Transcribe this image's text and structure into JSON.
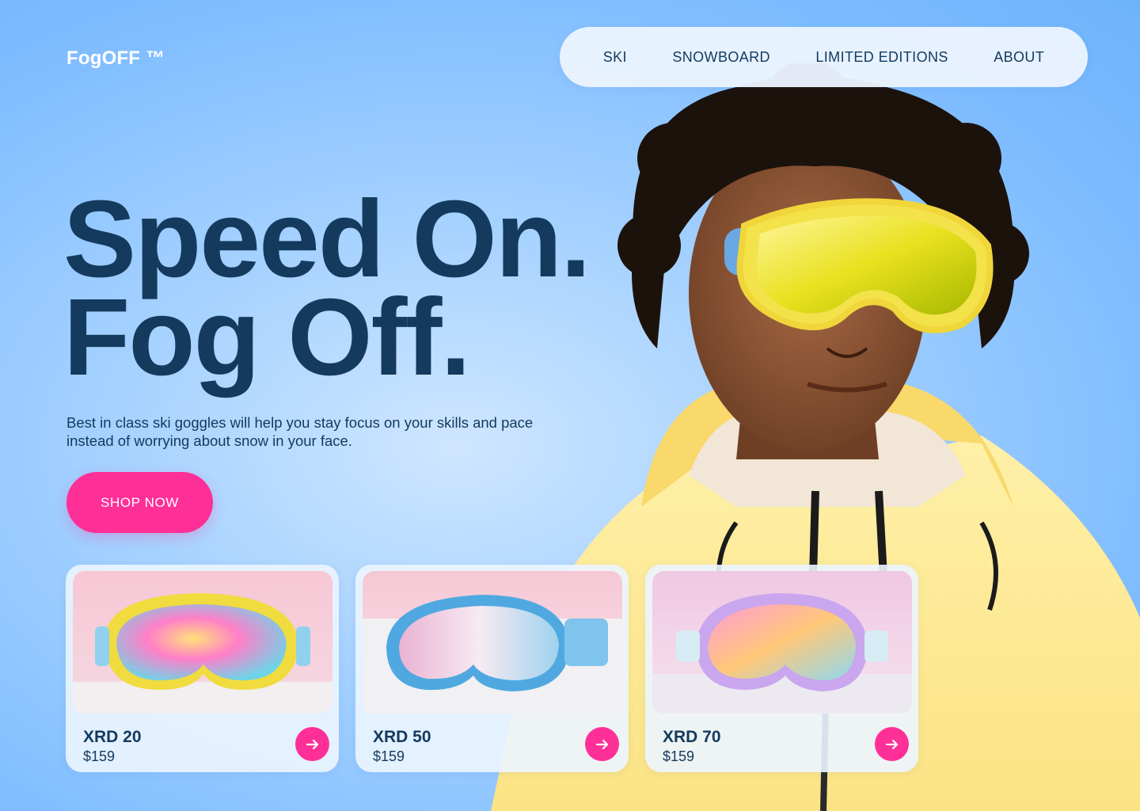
{
  "brand": {
    "name": "FogOFF ™"
  },
  "nav": {
    "items": [
      {
        "label": "SKI"
      },
      {
        "label": "SNOWBOARD"
      },
      {
        "label": "LIMITED EDITIONS"
      },
      {
        "label": "ABOUT"
      }
    ]
  },
  "hero": {
    "headline_line1": "Speed On.",
    "headline_line2": "Fog Off.",
    "subtext": "Best in class ski goggles will help you stay focus on your skills and pace instead of worrying about snow in your face.",
    "cta_label": "SHOP NOW"
  },
  "products": [
    {
      "name": "XRD 20",
      "price": "$159"
    },
    {
      "name": "XRD 50",
      "price": "$159"
    },
    {
      "name": "XRD 70",
      "price": "$159"
    }
  ],
  "colors": {
    "accent": "#ff2f98",
    "text_dark": "#143a5e",
    "background": "#7ebcff"
  },
  "icons": {
    "card_arrow": "arrow-right-icon"
  }
}
